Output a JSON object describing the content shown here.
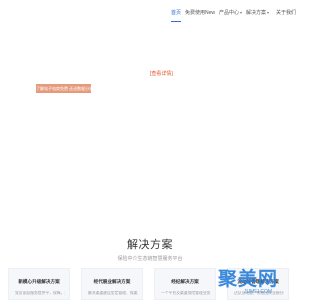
{
  "nav": {
    "items": [
      {
        "label": "首页"
      },
      {
        "label": "免费使用New"
      },
      {
        "label": "产品中心",
        "has_dropdown": true
      },
      {
        "label": "解决方案",
        "has_dropdown": true
      },
      {
        "label": "关于我们"
      }
    ],
    "active_index": 0,
    "active_color": "#2f6fd6"
  },
  "hero": {
    "detail_link": "[查看详情]",
    "banner_text": "了解电子电商免费 还送数据分析",
    "banner_color": "#e69a7c"
  },
  "solutions": {
    "title": "解决方案",
    "subtitle": "保险中介生态链智慧服务平台",
    "cards": [
      {
        "title": "新模心升级解决方案",
        "desc": "党员家庭服务提供平，保障，分"
      },
      {
        "title": "经代展业解决方案",
        "desc": "解决渠道建设型定管理、保渠道"
      },
      {
        "title": "经纪解决方案",
        "desc": "一个平台及渠道保险管理业务，精"
      },
      {
        "title": "流动留管理解决方案",
        "desc": "达队员动量、销售团队业绩分析"
      }
    ]
  },
  "watermark": {
    "logo_text": "聚美网",
    "url": "JUMEI.COM",
    "color": "#2b7fd8"
  }
}
